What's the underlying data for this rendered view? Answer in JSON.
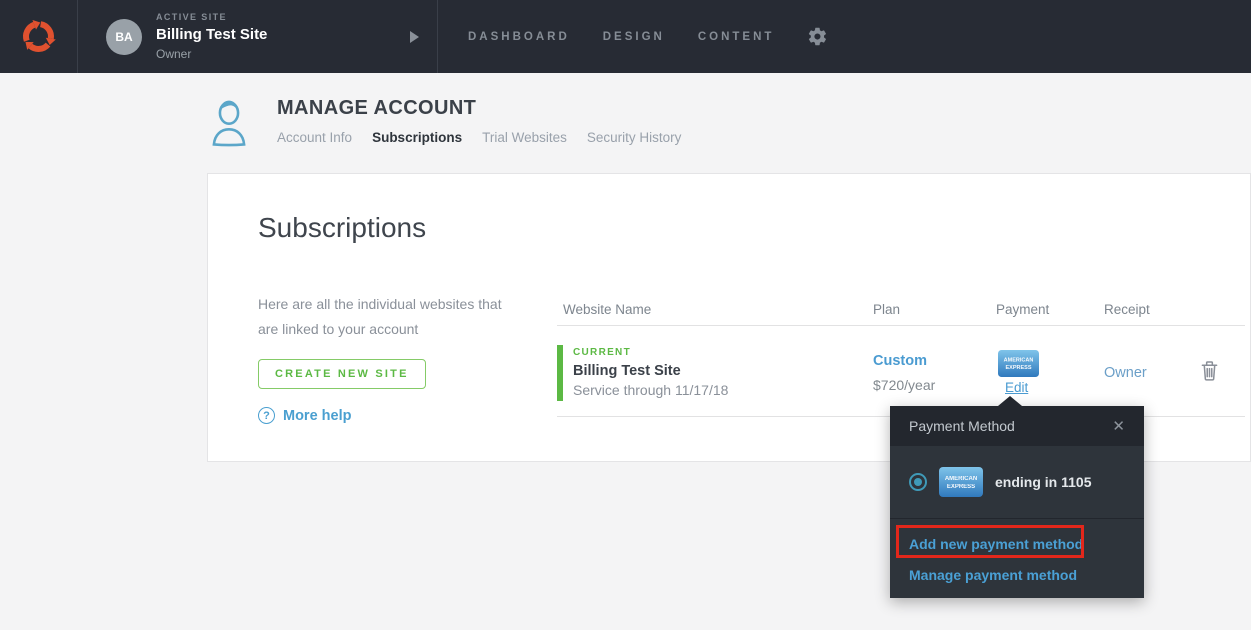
{
  "topbar": {
    "active_site_label": "ACTIVE SITE",
    "avatar_initials": "BA",
    "site_name": "Billing Test Site",
    "site_role": "Owner",
    "nav_items": [
      {
        "label": "DASHBOARD"
      },
      {
        "label": "DESIGN"
      },
      {
        "label": "CONTENT"
      }
    ]
  },
  "page_header": {
    "title": "MANAGE ACCOUNT",
    "tabs": [
      {
        "label": "Account Info"
      },
      {
        "label": "Subscriptions"
      },
      {
        "label": "Trial Websites"
      },
      {
        "label": "Security History"
      }
    ],
    "active_tab": "Subscriptions"
  },
  "panel": {
    "heading": "Subscriptions",
    "description": "Here are all the individual websites that are linked to your account",
    "create_button_label": "CREATE NEW SITE",
    "help_icon_glyph": "?",
    "more_help_label": "More help"
  },
  "table": {
    "headers": [
      "Website Name",
      "Plan",
      "Payment",
      "Receipt"
    ],
    "row": {
      "status_badge": "CURRENT",
      "website_name": "Billing Test Site",
      "service_text": "Service through 11/17/18",
      "plan_name": "Custom",
      "plan_price": "$720/year",
      "card_brand": "American Express",
      "card_line1": "AMERICAN",
      "card_line2": "EXPRESS",
      "edit_label": "Edit",
      "receipt_label": "Owner"
    }
  },
  "popup": {
    "title": "Payment Method",
    "close_glyph": "✕",
    "option": {
      "selected": true,
      "card_line1": "AMERICAN",
      "card_line2": "EXPRESS",
      "label": "ending in 1105"
    },
    "add_link_label": "Add new payment method",
    "manage_link_label": "Manage payment method"
  },
  "colors": {
    "brand_orange": "#e0512f",
    "accent_blue": "#4a9fd3",
    "success_green": "#5cb944",
    "annotation_red": "#e2271b",
    "topbar_bg": "#272b34",
    "popup_bg": "#2e343b"
  }
}
